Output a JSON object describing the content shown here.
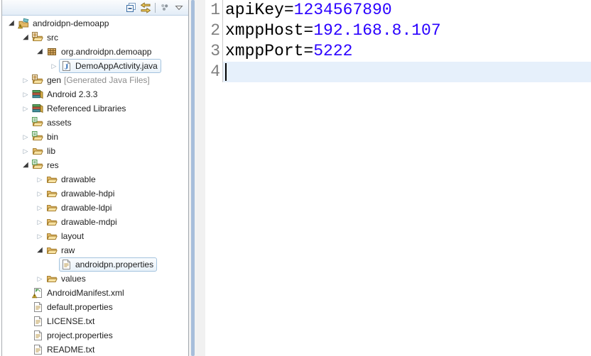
{
  "explorer": {
    "toolbar": {
      "icon_names": [
        "collapse-all-icon",
        "link-with-editor-icon",
        "view-menu-icon",
        "dropdown-arrow-icon"
      ]
    },
    "arrow_glyphs": {
      "expanded": "◢",
      "collapsed": "▷"
    },
    "selection_border_color": "#a3c3de",
    "tree": [
      {
        "label": "androidpn-demoapp",
        "level": 0,
        "arrow": "expanded",
        "icon": "android-project",
        "overlays": [
          "warning"
        ]
      },
      {
        "label": "src",
        "level": 1,
        "arrow": "expanded",
        "icon": "source-folder"
      },
      {
        "label": "org.androidpn.demoapp",
        "level": 2,
        "arrow": "expanded",
        "icon": "package"
      },
      {
        "label": "DemoAppActivity.java",
        "level": 3,
        "arrow": "collapsed",
        "icon": "java-file",
        "selected": true
      },
      {
        "label": "gen",
        "suffix": "[Generated Java Files]",
        "level": 1,
        "arrow": "collapsed",
        "icon": "source-folder"
      },
      {
        "label": "Android 2.3.3",
        "level": 1,
        "arrow": "collapsed",
        "icon": "library"
      },
      {
        "label": "Referenced Libraries",
        "level": 1,
        "arrow": "collapsed",
        "icon": "library"
      },
      {
        "label": "assets",
        "level": 1,
        "arrow": "none",
        "icon": "folder-dec"
      },
      {
        "label": "bin",
        "level": 1,
        "arrow": "collapsed",
        "icon": "folder-dec"
      },
      {
        "label": "lib",
        "level": 1,
        "arrow": "collapsed",
        "icon": "folder"
      },
      {
        "label": "res",
        "level": 1,
        "arrow": "expanded",
        "icon": "folder-dec"
      },
      {
        "label": "drawable",
        "level": 2,
        "arrow": "collapsed",
        "icon": "folder"
      },
      {
        "label": "drawable-hdpi",
        "level": 2,
        "arrow": "collapsed",
        "icon": "folder"
      },
      {
        "label": "drawable-ldpi",
        "level": 2,
        "arrow": "collapsed",
        "icon": "folder"
      },
      {
        "label": "drawable-mdpi",
        "level": 2,
        "arrow": "collapsed",
        "icon": "folder"
      },
      {
        "label": "layout",
        "level": 2,
        "arrow": "collapsed",
        "icon": "folder"
      },
      {
        "label": "raw",
        "level": 2,
        "arrow": "expanded",
        "icon": "folder"
      },
      {
        "label": "androidpn.properties",
        "level": 3,
        "arrow": "none",
        "icon": "text-file",
        "selected": true
      },
      {
        "label": "values",
        "level": 2,
        "arrow": "collapsed",
        "icon": "folder"
      },
      {
        "label": "AndroidManifest.xml",
        "level": 1,
        "arrow": "none",
        "icon": "manifest-file",
        "overlays": [
          "warning"
        ]
      },
      {
        "label": "default.properties",
        "level": 1,
        "arrow": "none",
        "icon": "text-file"
      },
      {
        "label": "LICENSE.txt",
        "level": 1,
        "arrow": "none",
        "icon": "text-file"
      },
      {
        "label": "project.properties",
        "level": 1,
        "arrow": "none",
        "icon": "text-file"
      },
      {
        "label": "README.txt",
        "level": 1,
        "arrow": "none",
        "icon": "text-file"
      }
    ]
  },
  "editor": {
    "lines": [
      {
        "number": "1",
        "key": "apiKey",
        "sep": "=",
        "value": "1234567890"
      },
      {
        "number": "2",
        "key": "xmppHost",
        "sep": "=",
        "value": "192.168.8.107"
      },
      {
        "number": "3",
        "key": "xmppPort",
        "sep": "=",
        "value": "5222"
      },
      {
        "number": "4",
        "key": "",
        "sep": "",
        "value": "",
        "current": true
      }
    ],
    "colors": {
      "key_text": "#000000",
      "value_text": "#2A00FF",
      "line_number": "#7f7f7f",
      "current_line_bg": "#e6f0fb",
      "cursor": "#000000"
    }
  }
}
